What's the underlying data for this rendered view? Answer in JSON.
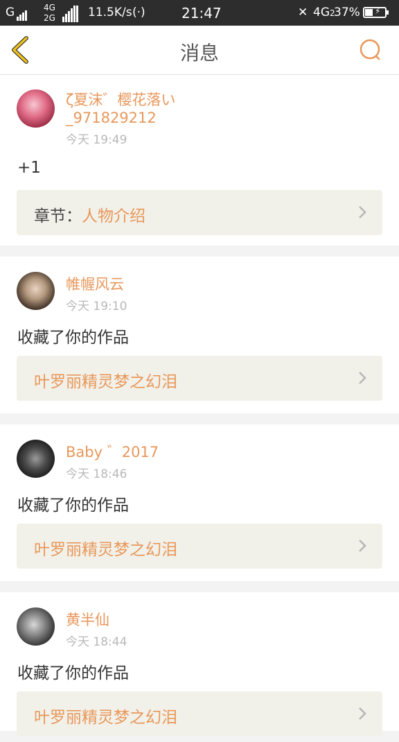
{
  "status_bar": {
    "carrier_g": "G",
    "net_4g": "4G",
    "net_2g": "2G",
    "speed": "11.5K/s",
    "time": "21:47",
    "net_4g2": "4G",
    "net_4g2_sub": "2",
    "battery": "37%"
  },
  "header": {
    "title": "消息"
  },
  "messages": [
    {
      "username": "ζ夏沫゛樱花落い\n_971829212",
      "time": "今天 19:49",
      "text": "+1",
      "ref_prefix": "章节：",
      "ref_value": "人物介绍"
    },
    {
      "username": "帷幄风云",
      "time": "今天 19:10",
      "text": "收藏了你的作品",
      "ref_prefix": "",
      "ref_value": "叶罗丽精灵梦之幻泪"
    },
    {
      "username": "Baby ゛2017",
      "time": "今天 18:46",
      "text": "收藏了你的作品",
      "ref_prefix": "",
      "ref_value": "叶罗丽精灵梦之幻泪"
    },
    {
      "username": "黄半仙",
      "time": "今天 18:44",
      "text": "收藏了你的作品",
      "ref_prefix": "",
      "ref_value": "叶罗丽精灵梦之幻泪"
    }
  ],
  "colors": {
    "accent": "#e8975a",
    "back_icon": "#f0c419",
    "status_bar": "#2d2d2d",
    "ref_bg": "#f2f1e9"
  },
  "icons": {
    "back": "chevron-left-icon",
    "search": "search-icon",
    "chevron": "chevron-right-icon"
  }
}
